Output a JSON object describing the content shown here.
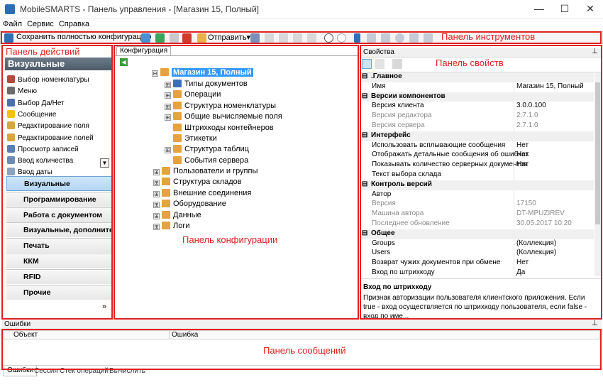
{
  "window": {
    "title": "MobileSMARTS - Панель управления - [Магазин 15, Полный]",
    "minimize": "—",
    "maximize": "☐",
    "close": "✕"
  },
  "menu": [
    "Файл",
    "Сервис",
    "Справка"
  ],
  "toolbar": {
    "save_label": "Сохранить полностью конфигурацию",
    "send_label": "Отправить",
    "send_arrow": "▾"
  },
  "annotations": {
    "toolbar": "Панель инструментов",
    "actions": "Панель действий",
    "config": "Панель конфигурации",
    "props": "Панель свойств",
    "messages": "Панель сообщений"
  },
  "actions": {
    "header": "Визуальные",
    "items": [
      "Выбор номенклатуры",
      "Меню",
      "Выбор Да/Нет",
      "Сообщение",
      "Редактирование поля",
      "Редактирование полей",
      "Просмотр записей",
      "Ввод количества",
      "Ввод даты"
    ],
    "categories": [
      "Визуальные",
      "Программирование",
      "Работа с документом",
      "Визуальные, дополнительные",
      "Печать",
      "ККМ",
      "RFID",
      "Прочие"
    ],
    "more": "»"
  },
  "config": {
    "tab": "Конфигурация",
    "root": "Магазин 15, Полный",
    "children": [
      "Типы документов",
      "Операции",
      "Структура номенклатуры",
      "Общие вычисляемые поля",
      "Штрихкоды контейнеров",
      "Этикетки",
      "Структура таблиц",
      "События сервера"
    ],
    "top": [
      "Пользователи и группы",
      "Структура складов",
      "Внешние соединения",
      "Оборудование",
      "Данные",
      "Логи"
    ]
  },
  "props": {
    "title": "Свойства",
    "pin": "⊥",
    "rows": [
      {
        "k": ".Главное",
        "cat": true
      },
      {
        "k": "Имя",
        "v": "Магазин 15, Полный"
      },
      {
        "k": "Версии компонентов",
        "cat": true
      },
      {
        "k": "Версия клиента",
        "v": "3.0.0.100"
      },
      {
        "k": "Версия редактора",
        "v": "2.7.1.0",
        "dis": true
      },
      {
        "k": "Версия сервера",
        "v": "2.7.1.0",
        "dis": true
      },
      {
        "k": "Интерфейс",
        "cat": true
      },
      {
        "k": "Использовать всплывающие сообщения",
        "v": "Нет"
      },
      {
        "k": "Отображать детальные сообщения об ошибках",
        "v": "Нет"
      },
      {
        "k": "Показывать количество серверных документов",
        "v": "Нет"
      },
      {
        "k": "Текст выбора склада",
        "v": ""
      },
      {
        "k": "Контроль версий",
        "cat": true
      },
      {
        "k": "Автор",
        "v": ""
      },
      {
        "k": "Версия",
        "v": "17150",
        "dis": true
      },
      {
        "k": "Машина автора",
        "v": "DT-MPUZIREV",
        "dis": true
      },
      {
        "k": "Последнее обновление",
        "v": "30.05.2017 10:20",
        "dis": true
      },
      {
        "k": "Общее",
        "cat": true
      },
      {
        "k": "Groups",
        "v": "(Коллекция)"
      },
      {
        "k": "Users",
        "v": "(Коллекция)"
      },
      {
        "k": "Возврат чужих документов при обмене",
        "v": "Нет"
      },
      {
        "k": "Вход по штрихкоду",
        "v": "Да"
      }
    ],
    "desc_title": "Вход по штрихкоду",
    "desc_text": "Признак авторизации пользователя клиентского приложения. Если true - вход осуществляется по штрихкоду пользователя, если false - вход по име..."
  },
  "messages": {
    "title": "Ошибки",
    "pin": "⊥",
    "columns": [
      "Объект",
      "Ошибка"
    ],
    "tabs": [
      "Ошибки",
      "Сессия",
      "Стек операций",
      "Вычислить"
    ]
  },
  "colors": {
    "annotation": "#e02020",
    "selection": "#3399ff",
    "header": "#5a6673"
  }
}
